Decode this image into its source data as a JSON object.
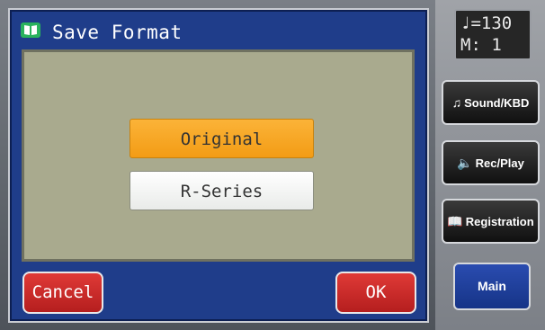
{
  "dialog": {
    "title": "Save Format",
    "icon": "book-icon",
    "options": [
      "Original",
      "R-Series"
    ],
    "selected": "Original",
    "cancel_label": "Cancel",
    "ok_label": "OK"
  },
  "status": {
    "tempo_line": "♩=130",
    "measure_line": "M:   1"
  },
  "side_buttons": {
    "sound_kbd": "Sound/KBD",
    "rec_play": "Rec/Play",
    "registration": "Registration",
    "main": "Main"
  },
  "colors": {
    "dialog_bg": "#1f3d8a",
    "content_bg": "#a9aa8e",
    "selected_option": "#f6a320",
    "button_red": "#c72a28",
    "main_button": "#1f3f9c"
  }
}
